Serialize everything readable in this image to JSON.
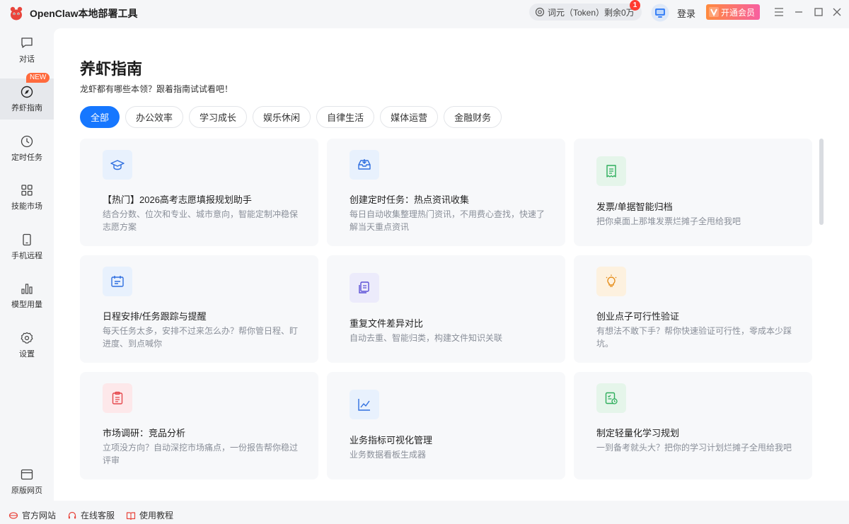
{
  "app": {
    "title": "OpenClaw本地部署工具",
    "token_label": "词元（Token）剩余0万",
    "token_badge": "1",
    "login_label": "登录",
    "vip_label": "开通会员",
    "vip_icon": "V"
  },
  "sidebar": {
    "items": [
      {
        "label": "对话",
        "icon": "chat-icon"
      },
      {
        "label": "养虾指南",
        "icon": "compass-icon"
      },
      {
        "label": "定时任务",
        "icon": "clock-icon"
      },
      {
        "label": "技能市场",
        "icon": "grid-icon"
      },
      {
        "label": "手机远程",
        "icon": "phone-icon"
      },
      {
        "label": "模型用量",
        "icon": "bar-chart-icon"
      },
      {
        "label": "设置",
        "icon": "gear-icon"
      }
    ],
    "new_tag": "NEW",
    "bottom_item": {
      "label": "原版网页",
      "icon": "browser-icon"
    }
  },
  "main": {
    "title": "养虾指南",
    "subtitle": "龙虾都有哪些本领？跟着指南试试看吧！",
    "tabs": [
      "全部",
      "办公效率",
      "学习成长",
      "娱乐休闲",
      "自律生活",
      "媒体运营",
      "金融财务"
    ],
    "cards": [
      {
        "title": "【热门】2026高考志愿填报规划助手",
        "desc": "结合分数、位次和专业、城市意向，智能定制冲稳保志愿方案",
        "icon": "graduation-cap-icon"
      },
      {
        "title": "创建定时任务：热点资讯收集",
        "desc": "每日自动收集整理热门资讯，不用费心查找，快速了解当天重点资讯",
        "icon": "inbox-icon"
      },
      {
        "title": "发票/单据智能归档",
        "desc": "把你桌面上那堆发票烂摊子全甩给我吧",
        "icon": "receipt-icon"
      },
      {
        "title": "日程安排/任务跟踪与提醒",
        "desc": "每天任务太多，安排不过来怎么办？帮你管日程、盯进度、到点喊你",
        "icon": "calendar-icon"
      },
      {
        "title": "重复文件差异对比",
        "desc": "自动去重、智能归类，构建文件知识关联",
        "icon": "files-icon"
      },
      {
        "title": "创业点子可行性验证",
        "desc": "有想法不敢下手？帮你快速验证可行性，零成本少踩坑。",
        "icon": "lightbulb-icon"
      },
      {
        "title": "市场调研：竞品分析",
        "desc": "立项没方向？自动深挖市场痛点，一份报告帮你稳过评审",
        "icon": "clipboard-icon"
      },
      {
        "title": "业务指标可视化管理",
        "desc": "业务数据看板生成器",
        "icon": "line-chart-icon"
      },
      {
        "title": "制定轻量化学习规划",
        "desc": "一到备考就头大？把你的学习计划烂摊子全甩给我吧",
        "icon": "plan-icon"
      }
    ]
  },
  "footer": {
    "links": [
      {
        "label": "官方网站",
        "icon": "globe-icon"
      },
      {
        "label": "在线客服",
        "icon": "headset-icon"
      },
      {
        "label": "使用教程",
        "icon": "book-icon"
      }
    ]
  },
  "colors": {
    "accent": "#1677ff",
    "brand": "#e8453c",
    "vip_start": "#ff8a3d",
    "vip_end": "#f75fa0",
    "badge": "#ff3b30"
  }
}
